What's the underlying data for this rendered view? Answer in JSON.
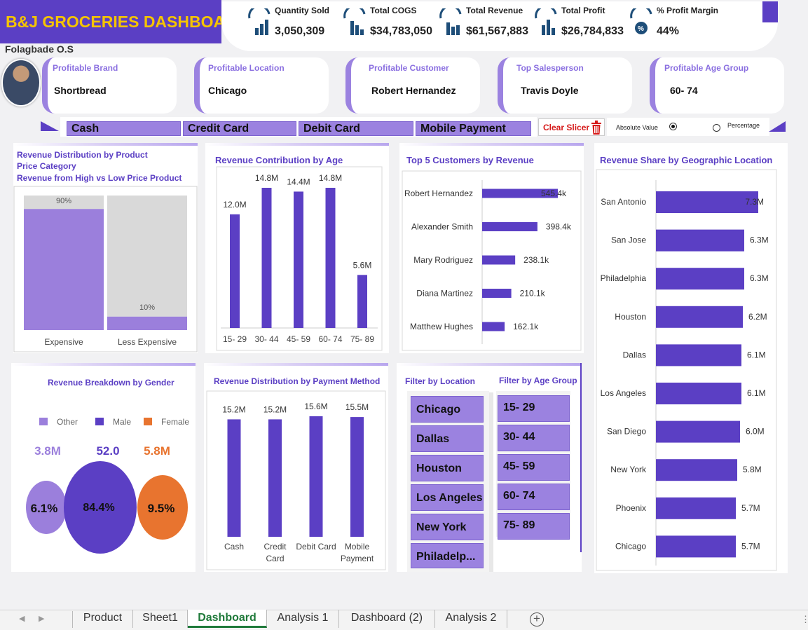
{
  "header": {
    "title": "B&J GROCERIES DASHBOARD",
    "author": "Folagbade O.S"
  },
  "kpis": [
    {
      "label": "Quantity Sold",
      "value": "3,050,309",
      "icon": "bar-chart-up-icon"
    },
    {
      "label": "Total COGS",
      "value": "$34,783,050",
      "icon": "bar-chart-down-icon"
    },
    {
      "label": "Total Revenue",
      "value": "$61,567,883",
      "icon": "growth-chart-icon"
    },
    {
      "label": "Total Profit",
      "value": "$26,784,833",
      "icon": "bar-chart-icon"
    },
    {
      "label": "% Profit Margin",
      "value": "44%",
      "icon": "percent-chart-icon"
    }
  ],
  "cards": [
    {
      "label": "Profitable Brand",
      "value": "Shortbread"
    },
    {
      "label": "Profitable Location",
      "value": "Chicago"
    },
    {
      "label": "Profitable Customer",
      "value": "Robert Hernandez"
    },
    {
      "label": "Top Salesperson",
      "value": "Travis Doyle"
    },
    {
      "label": "Profitable Age Group",
      "value": "60- 74"
    }
  ],
  "payment_slicer": [
    "Cash",
    "Credit Card",
    "Debit Card",
    "Mobile Payment"
  ],
  "clear_slicer": "Clear Slicer",
  "mode": {
    "absolute": "Absolute Value",
    "percentage": "Percentage",
    "selected": "absolute"
  },
  "panels": {
    "price": {
      "title1": "Revenue Distribution by Product",
      "title2": "Price Category",
      "title3": "Revenue from High vs Low Price Product"
    },
    "age": {
      "title": "Revenue Contribution by Age"
    },
    "customers": {
      "title": "Top 5 Customers by Revenue"
    },
    "geo": {
      "title": "Revenue Share by Geographic Location"
    },
    "gender": {
      "title": "Revenue Breakdown by Gender"
    },
    "payment": {
      "title": "Revenue Distribution by Payment Method"
    },
    "filters": {
      "location_title": "Filter by Location",
      "age_title": "Filter by Age Group"
    }
  },
  "chart_data": [
    {
      "id": "price",
      "type": "bar",
      "stacked": true,
      "categories": [
        "Expensive",
        "Less Expensive"
      ],
      "values": [
        90,
        10
      ],
      "data_labels": [
        "90%",
        "10%"
      ],
      "colors": {
        "value": "#9b7fdc",
        "remainder": "#d9d9d9"
      }
    },
    {
      "id": "age",
      "type": "bar",
      "categories": [
        "15- 29",
        "30- 44",
        "45- 59",
        "60- 74",
        "75- 89"
      ],
      "values": [
        12.0,
        14.8,
        14.4,
        14.8,
        5.6
      ],
      "data_labels": [
        "12.0M",
        "14.8M",
        "14.4M",
        "14.8M",
        "5.6M"
      ],
      "ylim": [
        0,
        16
      ],
      "color": "#5b3fc4"
    },
    {
      "id": "customers",
      "type": "bar",
      "orientation": "horizontal",
      "categories": [
        "Robert Hernandez",
        "Alexander Smith",
        "Mary Rodriguez",
        "Diana Martinez",
        "Matthew Hughes"
      ],
      "values": [
        545.4,
        398.4,
        238.1,
        210.1,
        162.1
      ],
      "data_labels": [
        "545.4k",
        "398.4k",
        "238.1k",
        "210.1k",
        "162.1k"
      ],
      "color": "#5b3fc4"
    },
    {
      "id": "geo",
      "type": "bar",
      "orientation": "horizontal",
      "categories": [
        "San Antonio",
        "San Jose",
        "Philadelphia",
        "Houston",
        "Dallas",
        "Los Angeles",
        "San Diego",
        "New York",
        "Phoenix",
        "Chicago"
      ],
      "values": [
        7.3,
        6.3,
        6.3,
        6.2,
        6.1,
        6.1,
        6.0,
        5.8,
        5.7,
        5.7
      ],
      "data_labels": [
        "7.3M",
        "6.3M",
        "6.3M",
        "6.2M",
        "6.1M",
        "6.1M",
        "6.0M",
        "5.8M",
        "5.7M",
        "5.7M"
      ],
      "color": "#5b3fc4"
    },
    {
      "id": "gender",
      "type": "scatter",
      "subtype": "bubble",
      "series": [
        {
          "name": "Other",
          "value_label": "3.8M",
          "share_label": "6.1%",
          "share": 6.1,
          "color": "#9b7fdc"
        },
        {
          "name": "Male",
          "value_label": "52.0",
          "share_label": "84.4%",
          "share": 84.4,
          "color": "#5b3fc4"
        },
        {
          "name": "Female",
          "value_label": "5.8M",
          "share_label": "9.5%",
          "share": 9.5,
          "color": "#e8742f"
        }
      ]
    },
    {
      "id": "payment",
      "type": "bar",
      "categories": [
        "Cash",
        "Credit Card",
        "Debit Card",
        "Mobile Payment"
      ],
      "values": [
        15.2,
        15.2,
        15.6,
        15.5
      ],
      "data_labels": [
        "15.2M",
        "15.2M",
        "15.6M",
        "15.5M"
      ],
      "ylim": [
        0,
        16
      ],
      "color": "#5b3fc4"
    }
  ],
  "filters": {
    "locations": [
      "Chicago",
      "Dallas",
      "Houston",
      "Los Angeles",
      "New York",
      "Philadelp..."
    ],
    "age_groups": [
      "15- 29",
      "30- 44",
      "45- 59",
      "60- 74",
      "75- 89"
    ]
  },
  "tabs": [
    "Product",
    "Sheet1",
    "Dashboard",
    "Analysis 1",
    "Dashboard (2)",
    "Analysis 2"
  ],
  "active_tab": "Dashboard",
  "colors": {
    "primary": "#5b3fc4",
    "light": "#9b82e0",
    "accent": "#f5c400",
    "female": "#e8742f"
  }
}
